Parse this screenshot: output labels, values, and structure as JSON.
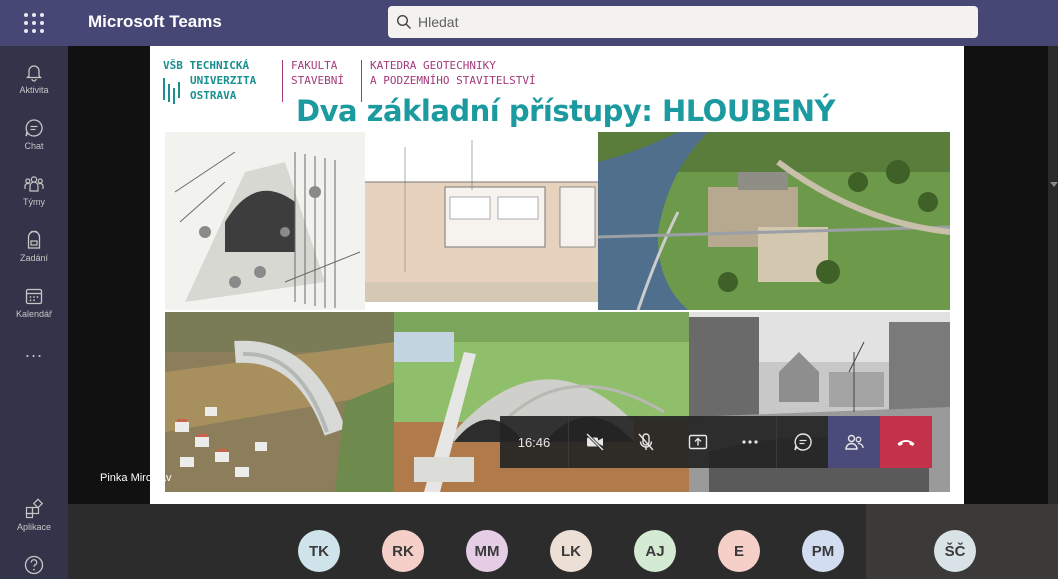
{
  "app": {
    "title": "Microsoft Teams"
  },
  "search": {
    "placeholder": "Hledat"
  },
  "rail": {
    "items": [
      {
        "label": "Aktivita",
        "icon": "bell-icon"
      },
      {
        "label": "Chat",
        "icon": "chat-icon"
      },
      {
        "label": "Týmy",
        "icon": "teams-icon"
      },
      {
        "label": "Zadání",
        "icon": "backpack-icon"
      },
      {
        "label": "Kalendář",
        "icon": "calendar-icon"
      }
    ],
    "more": "...",
    "apps_label": "Aplikace",
    "help_icon": "help-icon"
  },
  "slide": {
    "logo_line1": "VŠB TECHNICKÁ",
    "logo_line2": "UNIVERZITA",
    "logo_line3": "OSTRAVA",
    "faculty_line1": "FAKULTA",
    "faculty_line2": "STAVEBNÍ",
    "dept_line1": "KATEDRA GEOTECHNIKY",
    "dept_line2": "A PODZEMNÍHO STAVITELSTVÍ",
    "title": "Dva základní přístupy: HLOUBENÝ"
  },
  "presenter": {
    "name": "Pinka Miroslav"
  },
  "controls": {
    "time": "16:46",
    "buttons": [
      "camera-off-icon",
      "mic-off-icon",
      "share-screen-icon",
      "more-icon",
      "chat-icon",
      "participants-icon",
      "hang-up-icon"
    ]
  },
  "participants": [
    {
      "initials": "TK",
      "color": "#cfe4ea"
    },
    {
      "initials": "RK",
      "color": "#f5d0c8"
    },
    {
      "initials": "MM",
      "color": "#e6cde6"
    },
    {
      "initials": "LK",
      "color": "#ecdfd6"
    },
    {
      "initials": "AJ",
      "color": "#d4ead2"
    },
    {
      "initials": "E",
      "color": "#f5d0c8"
    },
    {
      "initials": "PM",
      "color": "#d3ddf2"
    }
  ],
  "self": {
    "initials": "ŠČ",
    "color": "#d9e2e6"
  },
  "colors": {
    "brand": "#464775",
    "rail": "#33344a",
    "hangup": "#c4314b",
    "slide_title": "#1b9aa0",
    "vsb": "#1b8f8f",
    "faculty": "#a23a7a"
  }
}
